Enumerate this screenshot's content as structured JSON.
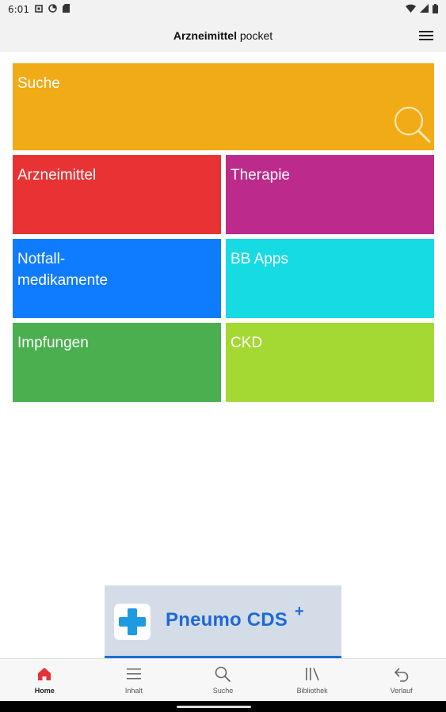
{
  "status_bar": {
    "time": "6:01",
    "left_icons": [
      "square-notification-icon",
      "data-saver-icon",
      "sd-card-icon"
    ],
    "right_icons": [
      "wifi-icon",
      "signal-icon",
      "battery-icon"
    ]
  },
  "app_bar": {
    "title_bold": "Arzneimittel",
    "title_light": " pocket",
    "menu_icon": "hamburger-menu-icon"
  },
  "tiles": {
    "search": {
      "label": "Suche",
      "color": "#f0ab17",
      "icon": "search-icon"
    },
    "drugs": {
      "label": "Arzneimittel",
      "color": "#e83233"
    },
    "therapy": {
      "label": "Therapie",
      "color": "#bc2b8b"
    },
    "emergency": {
      "label_line1": "Notfall-",
      "label_line2": "medikamente",
      "color": "#0f7bff"
    },
    "bb_apps": {
      "label": "BB Apps",
      "color": "#17dbe3"
    },
    "vaccinations": {
      "label": "Impfungen",
      "color": "#4baf4f"
    },
    "ckd": {
      "label": "CKD",
      "color": "#a4d833"
    }
  },
  "banner": {
    "text": "Pneumo CDS",
    "superscript": "+",
    "logo_icon": "medical-cross-icon",
    "accent": "#1d69d5"
  },
  "bottom_nav": {
    "items": [
      {
        "label": "Home",
        "icon": "home-icon",
        "active": true
      },
      {
        "label": "Inhalt",
        "icon": "list-icon",
        "active": false
      },
      {
        "label": "Suche",
        "icon": "search-icon",
        "active": false
      },
      {
        "label": "Bibliothek",
        "icon": "library-icon",
        "active": false
      },
      {
        "label": "Verlauf",
        "icon": "undo-icon",
        "active": false
      }
    ],
    "active_color": "#e83233"
  }
}
